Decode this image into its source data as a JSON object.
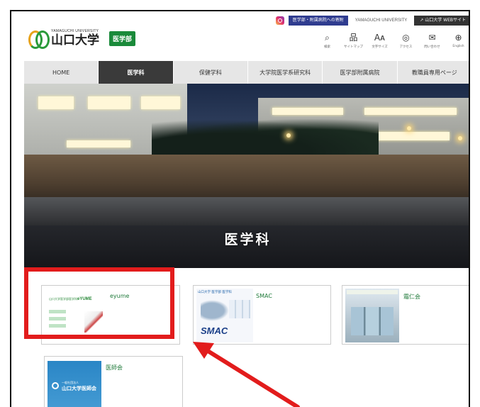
{
  "header": {
    "logo_en": "YAMAGUCHI UNIVERSITY",
    "logo_jp": "山口大学",
    "dept_badge": "医学部",
    "top_links": {
      "hospital_link": "医学部・附属病院への寄附",
      "university_en": "YAMAGUCHI UNIVERSITY",
      "univ_site": "山口大学 WEBサイト"
    },
    "util_nav": [
      {
        "icon": "search-icon",
        "glyph": "⌕",
        "label": "検索"
      },
      {
        "icon": "sitemap-icon",
        "glyph": "品",
        "label": "サイトマップ"
      },
      {
        "icon": "text-size-icon",
        "glyph": "Aᴀ",
        "label": "文字サイズ"
      },
      {
        "icon": "location-icon",
        "glyph": "◎",
        "label": "アクセス"
      },
      {
        "icon": "mail-icon",
        "glyph": "✉",
        "label": "問い合わせ"
      },
      {
        "icon": "globe-icon",
        "glyph": "⊕",
        "label": "English"
      }
    ]
  },
  "gnav": [
    {
      "label": "HOME",
      "active": false
    },
    {
      "label": "医学科",
      "active": true
    },
    {
      "label": "保健学科",
      "active": false
    },
    {
      "label": "大学院医学系研究科",
      "active": false
    },
    {
      "label": "医学部附属病院",
      "active": false
    },
    {
      "label": "教職員専用ページ",
      "active": false
    }
  ],
  "hero": {
    "title": "医学科"
  },
  "cards": {
    "eyume": {
      "title": "eyume",
      "logo_small": "山口大学医学部医学科",
      "logo_word": "eYUME"
    },
    "smac": {
      "title": "SMAC",
      "thumb_head": "山口大学 医学部 医学科",
      "thumb_logo": "SMAC"
    },
    "soujinkai": {
      "title": "霜仁会"
    },
    "ishikai": {
      "title": "医師会",
      "thumb_sub": "一般社団法人",
      "thumb_text": "山口大学医師会"
    }
  },
  "colors": {
    "brand_green": "#1a8a3a",
    "nav_active": "#3a3a3a",
    "highlight_red": "#e21c1c",
    "top_blue": "#2f3c8f"
  }
}
